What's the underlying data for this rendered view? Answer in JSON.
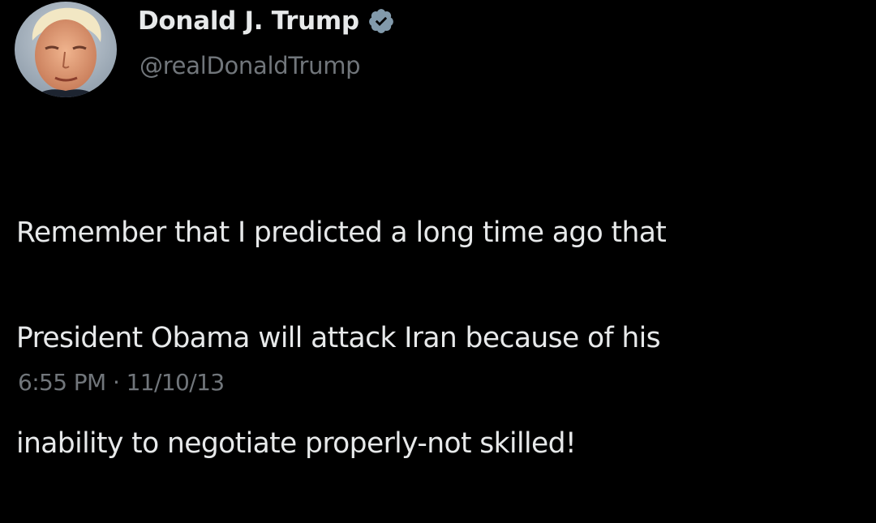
{
  "author": {
    "display_name": "Donald J. Trump",
    "handle": "@realDonaldTrump",
    "verified_icon": "verified-badge-icon",
    "avatar": "profile-photo"
  },
  "tweet": {
    "lines": [
      "Remember that I predicted a long time ago that",
      "President Obama will attack Iran because of his",
      "inability to negotiate properly-not skilled!"
    ]
  },
  "meta": {
    "time": "6:55 PM",
    "separator": "·",
    "date": "11/10/13"
  },
  "colors": {
    "background": "#000000",
    "primary_text": "#e7e9ea",
    "secondary_text": "#71767b",
    "verified_badge": "#829aab"
  }
}
